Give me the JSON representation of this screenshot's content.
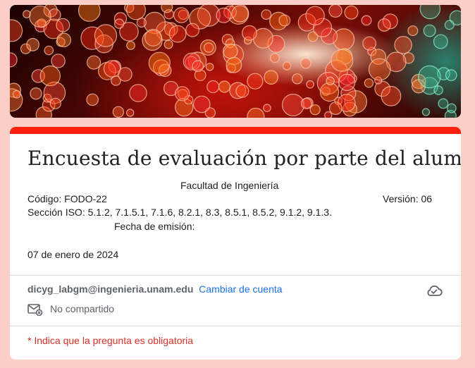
{
  "form": {
    "title": "Encuesta de evaluación por parte del alumno",
    "description": {
      "faculty": "Facultad de Ingeniería",
      "code": "Código:  FODO-22",
      "version": "Versión: 06",
      "iso_section": "Sección ISO: 5.1.2, 7.1.5.1, 7.1.6, 8.2.1, 8.3, 8.5.1, 8.5.2, 9.1.2, 9.1.3.",
      "issue_date_label": "Fecha de emisión:",
      "issue_date": "07 de enero de 2024"
    },
    "account": {
      "email": "dicyg_labgm@ingenieria.unam.edu",
      "switch_label": "Cambiar de cuenta",
      "sharing_status": "No compartido"
    },
    "required_note": "* Indica que la pregunta es obligatoria"
  },
  "colors": {
    "page_background": "#fbcfc8",
    "accent": "#ff1f0f",
    "link": "#1a73e8",
    "required": "#d93025"
  },
  "icons": {
    "cloud": "cloud-check-icon",
    "mail": "mail-not-shared-icon"
  }
}
